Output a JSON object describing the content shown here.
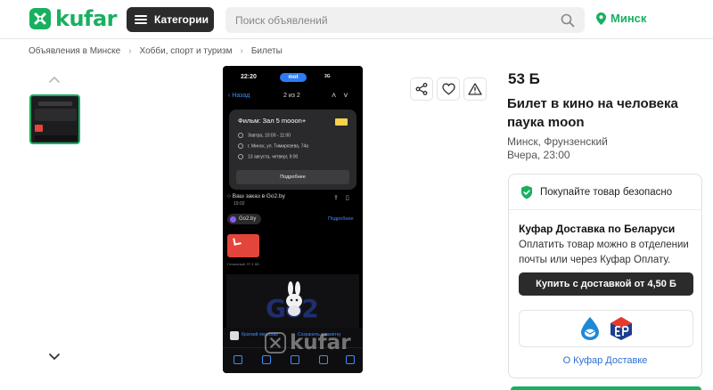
{
  "header": {
    "logo_text": "kufar",
    "categories_label": "Категории",
    "search_placeholder": "Поиск объявлений",
    "city": "Минск",
    "brand_color": "#18b060"
  },
  "breadcrumb": [
    "Объявления в Минске",
    "Хобби, спорт и туризм",
    "Билеты"
  ],
  "phone": {
    "time": "22:20",
    "pill": "mot",
    "net": "3G",
    "back": "Назад",
    "counter": "2 из 2",
    "film": "Фильм: Зал 5 mooon+",
    "line1": "Завтра, 10:00 - 11:00",
    "line2": "г. Минск, ул. Тимирязева, 74а",
    "line3": "13 августа, четверг, 9:00",
    "more": "Подробнее",
    "order": "Ваш заказ в Go2.by",
    "order_time": "19:02",
    "chip": "Go2.by",
    "chip_link": "Подробнее",
    "pdf_caption": "Готальный, 97.1 КБ",
    "video_logo": "Go2",
    "bottom_left": "Краткий пересказ",
    "bottom_right": "Сохранить в заметку"
  },
  "watermark": "kufar",
  "listing": {
    "price": "53 Б",
    "title": "Билет в кино на человека паука moon",
    "location": "Минск, Фрунзенский",
    "date": "Вчера, 23:00"
  },
  "delivery": {
    "safe": "Покупайте товар безопасно",
    "heading": "Куфар Доставка по Беларуси",
    "text": "Оплатить товар можно в отделении почты или через Куфар Оплату.",
    "button": "Купить с доставкой от 4,50 Б",
    "link": "О Куфар Доставке"
  }
}
